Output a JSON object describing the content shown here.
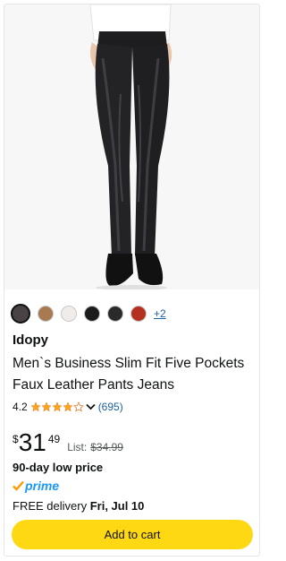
{
  "product": {
    "image_alt": "Man wearing black faux leather slim fit pants with black leather shoes",
    "swatch_colors": [
      "#4a4346",
      "#a77a52",
      "#efecea",
      "#1b1b1b",
      "#2a2a2a",
      "#b53020"
    ],
    "swatch_more": "+2",
    "brand": "Idopy",
    "title": "Men`s Business Slim Fit Five Pockets Faux Leather Pants Jeans",
    "rating": {
      "value": "4.2",
      "stars": 4.2,
      "review_count": "(695)"
    },
    "price": {
      "symbol": "$",
      "whole": "31",
      "fraction": "49",
      "list_label": "List:",
      "list_price": "$34.99"
    },
    "low_price_label": "90-day low price",
    "prime_label": "prime",
    "delivery": {
      "prefix": "FREE delivery ",
      "date": "Fri, Jul 10"
    },
    "add_to_cart_label": "Add to cart"
  },
  "colors": {
    "link": "#2162a1",
    "star": "#ffa41c",
    "button": "#ffd814",
    "prime": "#1a98ff"
  }
}
